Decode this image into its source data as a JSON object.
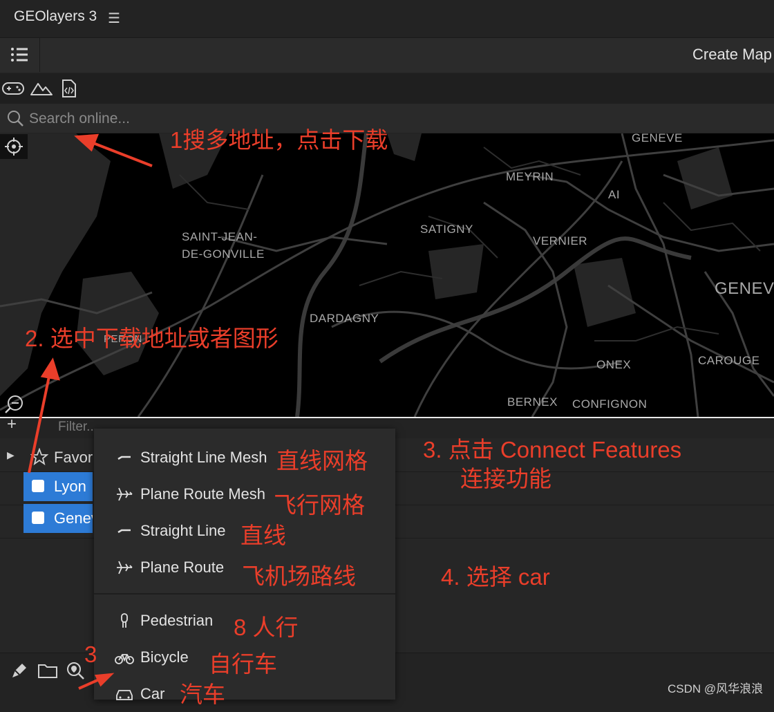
{
  "app": {
    "title": "GEOlayers 3"
  },
  "toolbar": {
    "create_map_label": "Create Map"
  },
  "search": {
    "placeholder": "Search online..."
  },
  "map": {
    "labels": [
      "GENEVE",
      "MEYRIN",
      "SATIGNY",
      "SAINT-JEAN-",
      "DE-GONVILLE",
      "VERNIER",
      "GENEV",
      "DARDAGNY",
      "PERON",
      "ONEX",
      "CAROUGE",
      "BERNEX",
      "CONFIGNON",
      "AI"
    ]
  },
  "filter": {
    "placeholder": "Filter..."
  },
  "layers": {
    "favorites_label": "Favor",
    "items": [
      "Lyon",
      "Genev"
    ]
  },
  "connect_menu": {
    "items": [
      {
        "label": "Straight Line Mesh",
        "icon": "line-icon"
      },
      {
        "label": "Plane Route Mesh",
        "icon": "plane-icon"
      },
      {
        "label": "Straight Line",
        "icon": "line-icon"
      },
      {
        "label": "Plane Route",
        "icon": "plane-icon"
      },
      {
        "label": "Pedestrian",
        "icon": "pedestrian-icon"
      },
      {
        "label": "Bicycle",
        "icon": "bicycle-icon"
      },
      {
        "label": "Car",
        "icon": "car-icon"
      }
    ]
  },
  "annotations": {
    "step1": "1搜多地址，点击下载",
    "step2": "2. 选中下载地址或者图形",
    "step3_line1": "3.  点击 Connect Features",
    "step3_line2": "连接功能",
    "step4": "4. 选择 car",
    "label_straight_line_mesh": "直线网格",
    "label_plane_route_mesh": "飞行网格",
    "label_straight_line": "直线",
    "label_plane_route": "飞机场路线",
    "label_pedestrian": "8 人行",
    "label_bicycle": "自行车",
    "label_car": "汽车",
    "label_three": "3"
  },
  "watermark": "CSDN @风华浪浪",
  "colors": {
    "annotation": "#ea3e2a",
    "selection": "#2d7bd6",
    "map_background": "#000000"
  }
}
